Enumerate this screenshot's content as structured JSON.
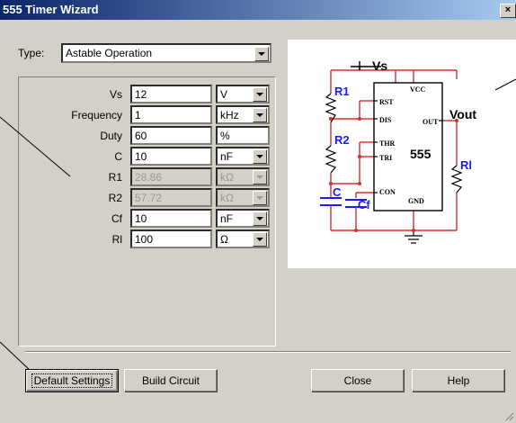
{
  "window": {
    "title": "555 Timer Wizard",
    "close_glyph": "×"
  },
  "type": {
    "label": "Type:",
    "value": "Astable Operation"
  },
  "params": [
    {
      "label": "Vs",
      "value": "12",
      "unit": "V",
      "value_enabled": true,
      "unit_enabled": true,
      "unit_dropdown": true
    },
    {
      "label": "Frequency",
      "value": "1",
      "unit": "kHz",
      "value_enabled": true,
      "unit_enabled": true,
      "unit_dropdown": true
    },
    {
      "label": "Duty",
      "value": "60",
      "unit": "%",
      "value_enabled": true,
      "unit_enabled": true,
      "unit_dropdown": false
    },
    {
      "label": "C",
      "value": "10",
      "unit": "nF",
      "value_enabled": true,
      "unit_enabled": true,
      "unit_dropdown": true
    },
    {
      "label": "R1",
      "value": "28.86",
      "unit": "kΩ",
      "value_enabled": false,
      "unit_enabled": false,
      "unit_dropdown": true
    },
    {
      "label": "R2",
      "value": "57.72",
      "unit": "kΩ",
      "value_enabled": false,
      "unit_enabled": false,
      "unit_dropdown": true
    },
    {
      "label": "Cf",
      "value": "10",
      "unit": "nF",
      "value_enabled": true,
      "unit_enabled": true,
      "unit_dropdown": true
    },
    {
      "label": "Rl",
      "value": "100",
      "unit": "Ω",
      "value_enabled": true,
      "unit_enabled": true,
      "unit_dropdown": true
    }
  ],
  "buttons": {
    "default_settings": "Default Settings",
    "build_circuit": "Build Circuit",
    "close": "Close",
    "help": "Help"
  },
  "schematic": {
    "vs": "Vs",
    "vout": "Vout",
    "r1": "R1",
    "r2": "R2",
    "c": "C",
    "cf": "Cf",
    "rl": "Rl",
    "chip": "555",
    "pin_vcc": "VCC",
    "pin_rst": "RST",
    "pin_dis": "DIS",
    "pin_thr": "THR",
    "pin_tri": "TRI",
    "pin_con": "CON",
    "pin_out": "OUT",
    "pin_gnd": "GND"
  },
  "colors": {
    "wire": "#d03030",
    "label": "#1a1aff",
    "title_start": "#0a246a",
    "title_end": "#a6caf0"
  }
}
